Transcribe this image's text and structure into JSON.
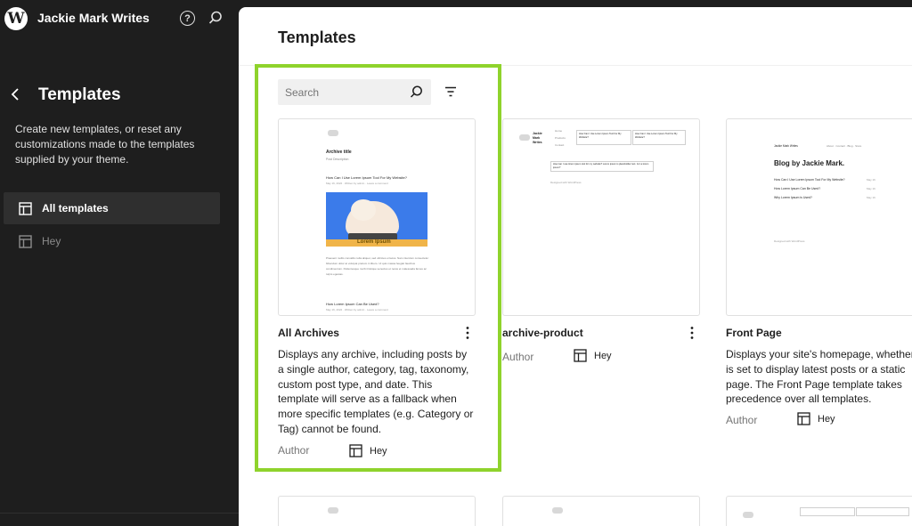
{
  "site": {
    "title": "Jackie Mark Writes"
  },
  "sidebar": {
    "title": "Templates",
    "description": "Create new templates, or reset any customizations made to the templates supplied by your theme.",
    "items": [
      {
        "label": "All templates",
        "active": true
      },
      {
        "label": "Hey",
        "active": false
      }
    ]
  },
  "main": {
    "title": "Templates",
    "search": {
      "placeholder": "Search",
      "value": ""
    }
  },
  "cards": [
    {
      "title": "All Archives",
      "description": "Displays any archive, including posts by a single author, category, tag, taxonomy, custom post type, and date. This template will serve as a fallback when more specific templates (e.g. Category or Tag) cannot be found.",
      "author_label": "Author",
      "author": "Hey",
      "preview": {
        "heading": "Archive title",
        "subheading": "Post Description",
        "post1": "How Can I Use Lorem Ipsum Tool For My Website?",
        "post1_meta": "May 16, 2022 · Written by admin · Leave a comment",
        "banner": "Lorem Ipsum",
        "body": "Praesent mollis convallis nulla aliquet, sed ultricies et lacus. Nam interdum consectetur bibendum dolor at volutpat pretium in libero. Ut quis massa feugiat faucibus condimentum. Pellentesque morbi tristique senectus et netus et malesuada fames ac turpis egestas.",
        "post2": "How Lorem Ipsum Can Be Used?",
        "post2_meta": "May 16, 2022 · Written by admin · Leave a comment"
      }
    },
    {
      "title": "archive-product",
      "author_label": "Author",
      "author": "Hey",
      "preview": {
        "site": "Jackie Mark Writes",
        "nav": [
          "Home",
          "Products",
          "Contact"
        ],
        "box1": "How Can I Use Lorem Ipsum Tool For My Website?",
        "box2": "How Can I Use Lorem Ipsum Tool For My Website?",
        "mid": "How can I use lorem ipsum tool for my website? Lorem ipsum is placeholder text. Is it a lorem ipsum?",
        "footer": "Designed with WordPress"
      }
    },
    {
      "title": "Front Page",
      "description": "Displays your site's homepage, whether it is set to display latest posts or a static page. The Front Page template takes precedence over all templates.",
      "author_label": "Author",
      "author": "Hey",
      "preview": {
        "site": "Jackie Mark Writes",
        "nav": "About · Contact · Blog · Store",
        "heading": "Blog by Jackie Mark.",
        "links": [
          "How Can I Use Lorem Ipsum Tool For My Website?",
          "How Lorem Ipsum Can Be Used?",
          "Why Lorem Ipsum is Used?"
        ],
        "dates": [
          "May 16",
          "May 16",
          "May 16"
        ],
        "footer": "Designed with WordPress"
      }
    }
  ],
  "colors": {
    "sidebar_bg": "#1e1e1e",
    "main_bg": "#ffffff",
    "highlight": "#8fd32c",
    "active_item_bg": "#2f2f2f"
  },
  "icons": {
    "logo": "wordpress-logo",
    "help": "help-circle-icon",
    "search": "search-icon",
    "back": "chevron-left-icon",
    "template": "layout-icon",
    "filter": "filter-icon",
    "more": "more-vertical-icon"
  }
}
